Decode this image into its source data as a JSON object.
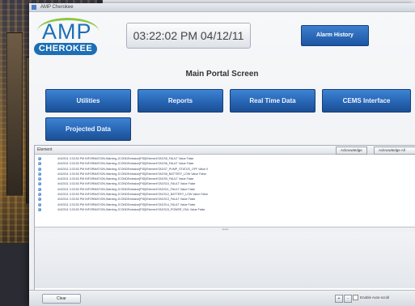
{
  "window": {
    "title": "AMP Cherokee"
  },
  "logo": {
    "line1": "AMP",
    "line2": "CHEROKEE"
  },
  "header": {
    "clock": "03:22:02 PM 04/12/11",
    "alarm_history_label": "Alarm History"
  },
  "page_title": "Main Portal Screen",
  "nav": {
    "utilities": "Utilities",
    "reports": "Reports",
    "real_time_data": "Real Time Data",
    "cems_interface": "CEMS Interface",
    "projected_data": "Projected Data"
  },
  "log": {
    "header_label": "Element",
    "acknowledge_label": "Acknowledge",
    "acknowledge_all_label": "Acknowledge All",
    "separator": "*****",
    "rows": [
      "4/4/2011 3:33:53 PM INFORMATION,Warning,JCONDEmission[PID]\\Element\\TAGS5_FAULT Value False",
      "4/4/2011 3:33:53 PM INFORMATION,Warning,JCONDEmission[PID]\\Element\\TAGS6_FAULT Value False",
      "4/4/2011 3:33:53 PM INFORMATION,Warning,JCONDEmission[PID]\\Element\\TAGS7_PUMP_STATUS_OFF Value 0",
      "4/4/2011 3:33:53 PM INFORMATION,Warning,JCONDEmission[PID]\\Element\\TAGS8_BATTERY_LOW Value False",
      "4/4/2011 3:33:53 PM INFORMATION,Warning,JCONDEmission[PID]\\Element\\TAGS9_FAULT Value False",
      "4/4/2011 3:33:53 PM INFORMATION,Warning,JCONDEmission[PID]\\Element\\TAGS10_FAULT Value False",
      "4/4/2011 3:33:53 PM INFORMATION,Warning,JCONDEmission[PID]\\Element\\TAGS11_FAULT Value False",
      "4/4/2011 3:33:53 PM INFORMATION,Warning,JCONDEmission[PID]\\Element\\TAGS12_BATTERY_LOW Value False",
      "4/4/2011 3:33:53 PM INFORMATION,Warning,JCONDEmission[PID]\\Element\\TAGS13_FAULT Value False",
      "4/4/2011 3:33:53 PM INFORMATION,Warning,JCONDEmission[PID]\\Element\\TAGS14_FAULT Value False",
      "4/4/2011 3:33:53 PM INFORMATION,Warning,JCONDEmission[PID]\\Element\\TAGS15_POWER_FAIL Value False"
    ]
  },
  "footer": {
    "clear_label": "Clear",
    "plus_label": "+",
    "minus_label": "-",
    "auto_scroll_label": "Enable Auto-scroll"
  },
  "colors": {
    "nav_button": "#2765b3",
    "brand_blue": "#1c6fb5",
    "brand_green": "#8cc63f"
  }
}
